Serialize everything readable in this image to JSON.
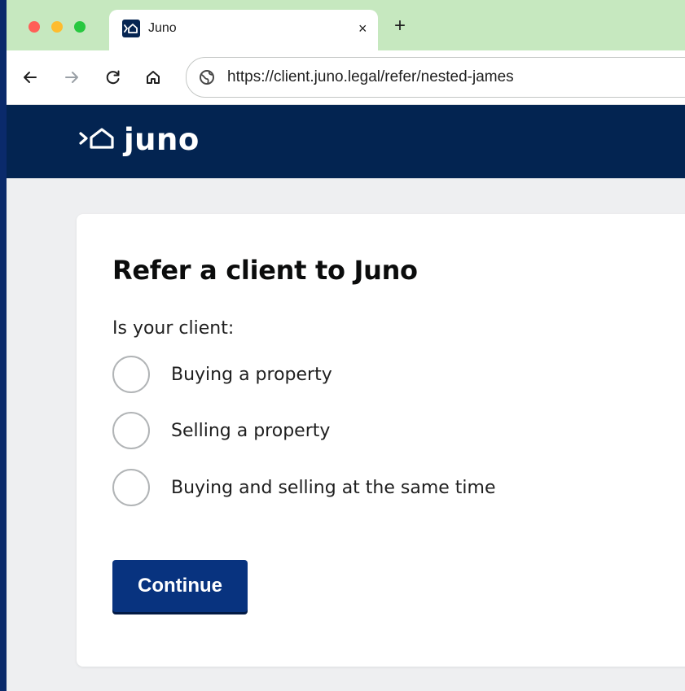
{
  "browser": {
    "tab_title": "Juno",
    "close_glyph": "×",
    "new_tab_glyph": "+",
    "url": "https://client.juno.legal/refer/nested-james"
  },
  "site": {
    "brand": "juno",
    "brand_color": "#032451"
  },
  "form": {
    "title": "Refer a client to Juno",
    "question": "Is your client:",
    "options": [
      {
        "label": "Buying a property",
        "selected": false
      },
      {
        "label": "Selling a property",
        "selected": false
      },
      {
        "label": "Buying and selling at the same time",
        "selected": false
      }
    ],
    "submit_label": "Continue",
    "button_color": "#08337f"
  },
  "icons": [
    "juno-logo-icon",
    "back-arrow-icon",
    "forward-arrow-icon",
    "reload-icon",
    "home-icon",
    "site-info-icon",
    "close-icon",
    "plus-icon"
  ]
}
